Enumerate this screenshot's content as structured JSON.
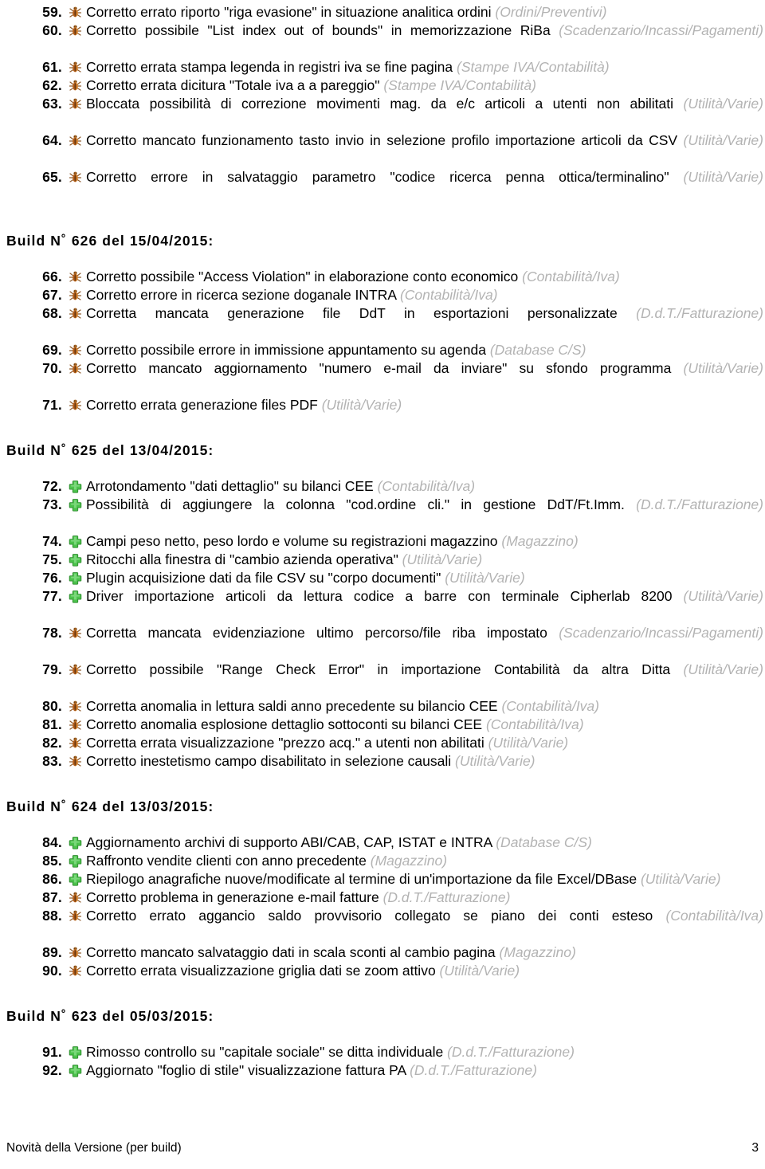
{
  "document": {
    "footer_left": "Novità della Versione (per build)",
    "footer_page": "3"
  },
  "colors": {
    "text": "#000000",
    "category": "#b3b3b3",
    "bug_icon": "#c8661e",
    "feature_icon": "#4cc24c"
  },
  "icons": {
    "bug": "bug-icon",
    "feature": "plus-icon"
  },
  "continued_build": {
    "items": [
      {
        "num": "59.",
        "icon": "bug",
        "text": "Corretto errato riporto \"riga evasione\" in situazione analitica ordini",
        "category": "(Ordini/Preventivi)",
        "justify": false
      },
      {
        "num": "60.",
        "icon": "bug",
        "text": "Corretto possibile \"List index out of bounds\" in memorizzazione RiBa",
        "category": "(Scadenzario/Incassi/Pagamenti)",
        "justify": true
      },
      {
        "num": "61.",
        "icon": "bug",
        "text": "Corretto errata stampa legenda in registri iva se fine pagina",
        "category": "(Stampe IVA/Contabilità)",
        "justify": false
      },
      {
        "num": "62.",
        "icon": "bug",
        "text": "Corretto errata dicitura \"Totale iva a a pareggio\"",
        "category": "(Stampe IVA/Contabilità)",
        "justify": false
      },
      {
        "num": "63.",
        "icon": "bug",
        "text": "Bloccata possibilità di correzione movimenti mag. da e/c articoli a utenti non abilitati",
        "category": "(Utilità/Varie)",
        "justify": true
      },
      {
        "num": "64.",
        "icon": "bug",
        "text": "Corretto mancato funzionamento tasto invio in selezione profilo importazione articoli da CSV",
        "category": "(Utilità/Varie)",
        "justify": true
      },
      {
        "num": "65.",
        "icon": "bug",
        "text": "Corretto errore in salvataggio parametro \"codice ricerca penna ottica/terminalino\"",
        "category": "(Utilità/Varie)",
        "justify": true
      }
    ]
  },
  "builds": [
    {
      "header": "Build N˚ 626 del 15/04/2015:",
      "items": [
        {
          "num": "66.",
          "icon": "bug",
          "text": "Corretto possibile \"Access Violation\" in elaborazione conto economico",
          "category": "(Contabilità/Iva)",
          "justify": false
        },
        {
          "num": "67.",
          "icon": "bug",
          "text": "Corretto errore in ricerca sezione doganale INTRA",
          "category": "(Contabilità/Iva)",
          "justify": false
        },
        {
          "num": "68.",
          "icon": "bug",
          "text": "Corretta mancata generazione file DdT in esportazioni personalizzate",
          "category": "(D.d.T./Fatturazione)",
          "justify": true
        },
        {
          "num": "69.",
          "icon": "bug",
          "text": "Corretto possibile errore in immissione appuntamento su agenda",
          "category": "(Database C/S)",
          "justify": false
        },
        {
          "num": "70.",
          "icon": "bug",
          "text": "Corretto mancato aggiornamento \"numero e-mail da inviare\" su sfondo programma",
          "category": "(Utilità/Varie)",
          "justify": true
        },
        {
          "num": "71.",
          "icon": "bug",
          "text": "Corretto errata generazione files PDF",
          "category": "(Utilità/Varie)",
          "justify": false
        }
      ]
    },
    {
      "header": "Build N˚ 625 del 13/04/2015:",
      "items": [
        {
          "num": "72.",
          "icon": "feature",
          "text": "Arrotondamento \"dati dettaglio\" su bilanci CEE",
          "category": "(Contabilità/Iva)",
          "justify": false
        },
        {
          "num": "73.",
          "icon": "feature",
          "text": "Possibilità di aggiungere la colonna \"cod.ordine cli.\" in gestione DdT/Ft.Imm.",
          "category": "(D.d.T./Fatturazione)",
          "justify": true
        },
        {
          "num": "74.",
          "icon": "feature",
          "text": "Campi peso netto, peso lordo e volume su registrazioni  magazzino",
          "category": "(Magazzino)",
          "justify": false
        },
        {
          "num": "75.",
          "icon": "feature",
          "text": "Ritocchi alla finestra di \"cambio azienda operativa\"",
          "category": "(Utilità/Varie)",
          "justify": false
        },
        {
          "num": "76.",
          "icon": "feature",
          "text": "Plugin acquisizione dati da file CSV su \"corpo documenti\"",
          "category": "(Utilità/Varie)",
          "justify": false
        },
        {
          "num": "77.",
          "icon": "feature",
          "text": "Driver importazione articoli da lettura codice a barre con terminale Cipherlab 8200",
          "category": "(Utilità/Varie)",
          "justify": true
        },
        {
          "num": "78.",
          "icon": "bug",
          "text": "Corretta mancata evidenziazione ultimo percorso/file riba impostato",
          "category": "(Scadenzario/Incassi/Pagamenti)",
          "justify": true
        },
        {
          "num": "79.",
          "icon": "bug",
          "text": "Corretto possibile \"Range Check Error\" in importazione Contabilità da altra Ditta",
          "category": "(Utilità/Varie)",
          "justify": true
        },
        {
          "num": "80.",
          "icon": "bug",
          "text": "Corretta anomalia in lettura saldi anno precedente su bilancio CEE",
          "category": "(Contabilità/Iva)",
          "justify": false
        },
        {
          "num": "81.",
          "icon": "bug",
          "text": "Corretto anomalia esplosione dettaglio sottoconti su bilanci CEE",
          "category": "(Contabilità/Iva)",
          "justify": false
        },
        {
          "num": "82.",
          "icon": "bug",
          "text": "Corretta errata visualizzazione \"prezzo acq.\" a utenti non abilitati",
          "category": "(Utilità/Varie)",
          "justify": false
        },
        {
          "num": "83.",
          "icon": "bug",
          "text": "Corretto inestetismo campo disabilitato in selezione causali",
          "category": "(Utilità/Varie)",
          "justify": false
        }
      ]
    },
    {
      "header": "Build N˚ 624 del 13/03/2015:",
      "items": [
        {
          "num": "84.",
          "icon": "feature",
          "text": "Aggiornamento archivi di supporto ABI/CAB, CAP, ISTAT e INTRA",
          "category": "(Database C/S)",
          "justify": false
        },
        {
          "num": "85.",
          "icon": "feature",
          "text": "Raffronto vendite clienti con anno precedente",
          "category": "(Magazzino)",
          "justify": false
        },
        {
          "num": "86.",
          "icon": "feature",
          "text": "Riepilogo anagrafiche nuove/modificate al termine di un'importazione da file Excel/DBase",
          "category": "(Utilità/Varie)",
          "justify": false
        },
        {
          "num": "87.",
          "icon": "bug",
          "text": "Corretto problema in generazione e-mail fatture",
          "category": "(D.d.T./Fatturazione)",
          "justify": false
        },
        {
          "num": "88.",
          "icon": "bug",
          "text": "Corretto errato aggancio saldo provvisorio collegato se piano dei conti esteso",
          "category": "(Contabilità/Iva)",
          "justify": true
        },
        {
          "num": "89.",
          "icon": "bug",
          "text": "Corretto mancato salvataggio dati in scala sconti al cambio pagina",
          "category": "(Magazzino)",
          "justify": false
        },
        {
          "num": "90.",
          "icon": "bug",
          "text": "Corretto errata visualizzazione griglia dati se zoom attivo",
          "category": "(Utilità/Varie)",
          "justify": false
        }
      ]
    },
    {
      "header": "Build N˚ 623 del 05/03/2015:",
      "items": [
        {
          "num": "91.",
          "icon": "feature",
          "text": "Rimosso controllo su \"capitale sociale\" se ditta individuale",
          "category": "(D.d.T./Fatturazione)",
          "justify": false
        },
        {
          "num": "92.",
          "icon": "feature",
          "text": "Aggiornato \"foglio di stile\" visualizzazione fattura PA",
          "category": "(D.d.T./Fatturazione)",
          "justify": false
        }
      ]
    }
  ]
}
